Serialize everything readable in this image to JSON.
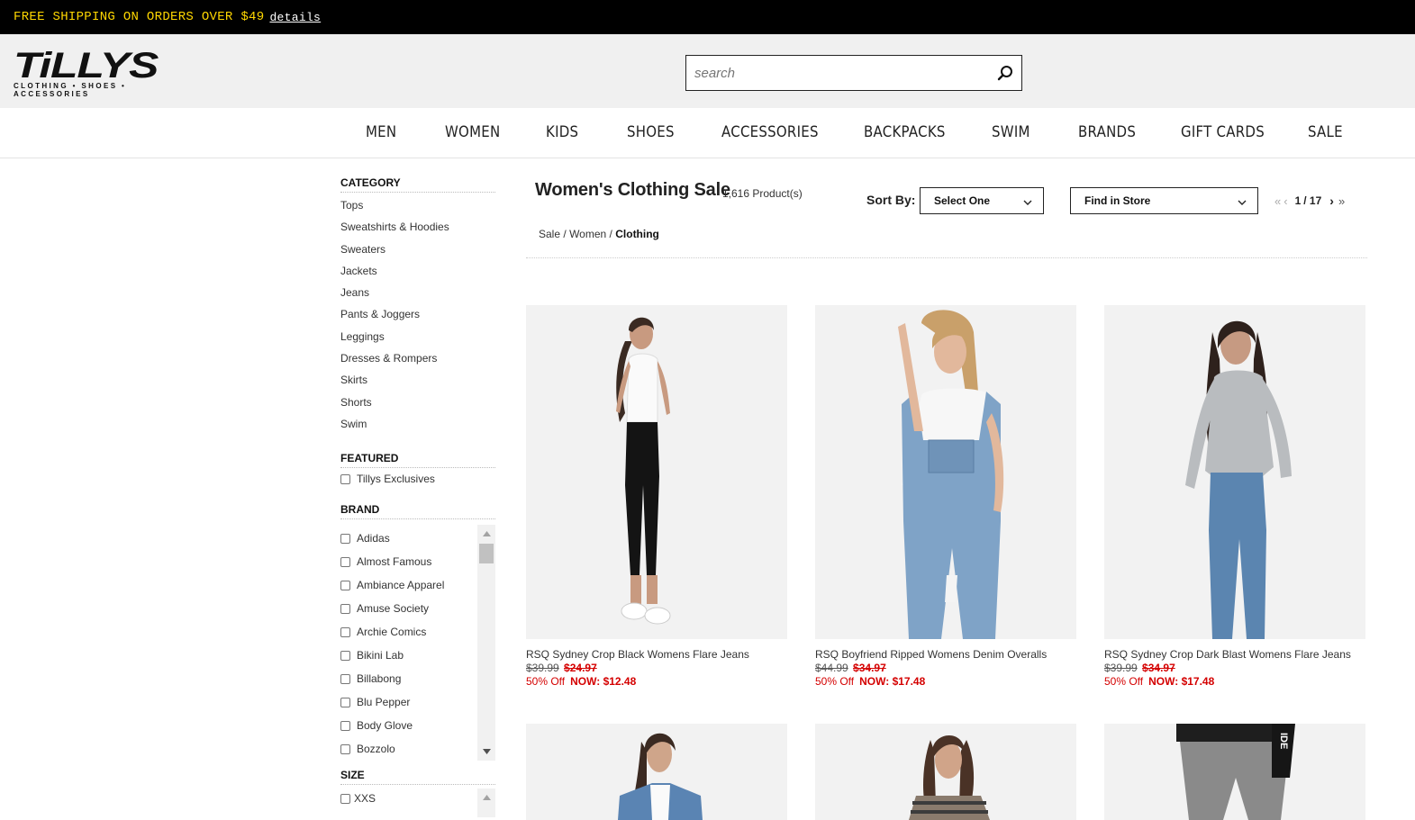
{
  "promo": {
    "text": "FREE SHIPPING ON ORDERS OVER $49",
    "link": "details"
  },
  "logo": {
    "name": "TiLLYS",
    "tagline": "CLOTHING • SHOES • ACCESSORIES"
  },
  "search": {
    "placeholder": "search"
  },
  "nav": [
    "MEN",
    "WOMEN",
    "KIDS",
    "SHOES",
    "ACCESSORIES",
    "BACKPACKS",
    "SWIM",
    "BRANDS",
    "GIFT CARDS",
    "SALE"
  ],
  "sidebar": {
    "category": {
      "title": "CATEGORY",
      "items": [
        "Tops",
        "Sweatshirts & Hoodies",
        "Sweaters",
        "Jackets",
        "Jeans",
        "Pants & Joggers",
        "Leggings",
        "Dresses & Rompers",
        "Skirts",
        "Shorts",
        "Swim"
      ]
    },
    "featured": {
      "title": "FEATURED",
      "items": [
        "Tillys Exclusives"
      ]
    },
    "brand": {
      "title": "BRAND",
      "items": [
        "Adidas",
        "Almost Famous",
        "Ambiance Apparel",
        "Amuse Society",
        "Archie Comics",
        "Bikini Lab",
        "Billabong",
        "Blu Pepper",
        "Body Glove",
        "Bozzolo"
      ]
    },
    "size": {
      "title": "SIZE",
      "items": [
        "XXS"
      ]
    }
  },
  "listing": {
    "title": "Women's Clothing Sale",
    "count": "1,616 Product(s)",
    "sort_label": "Sort By:",
    "sort_value": "Select One",
    "store_value": "Find in Store",
    "page_current": "1",
    "page_total": "/ 17",
    "breadcrumb": {
      "a": "Sale",
      "sep1": "/",
      "b": "Women",
      "sep2": "/",
      "c": "Clothing"
    }
  },
  "products": [
    {
      "name": "RSQ Sydney Crop Black Womens Flare Jeans",
      "was": "$39.99",
      "sale": "$24.97",
      "off": "50% Off",
      "now": "NOW: $12.48"
    },
    {
      "name": "RSQ Boyfriend Ripped Womens Denim Overalls",
      "was": "$44.99",
      "sale": "$34.97",
      "off": "50% Off",
      "now": "NOW: $17.48"
    },
    {
      "name": "RSQ Sydney Crop Dark Blast Womens Flare Jeans",
      "was": "$39.99",
      "sale": "$34.97",
      "off": "50% Off",
      "now": "NOW: $17.48"
    }
  ],
  "colors": {
    "promo_text": "#ffd700",
    "sale_red": "#d40000",
    "header_bg": "#f0f0f0"
  }
}
